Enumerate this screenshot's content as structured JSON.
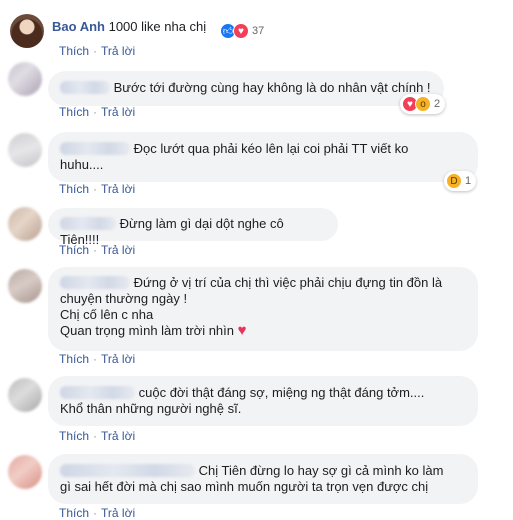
{
  "comments": [
    {
      "author": "Bao Anh",
      "lines": [
        "1000 like nha chị"
      ],
      "actions": {
        "like": "Thích",
        "reply": "Trả lời"
      },
      "reactions": {
        "count": "37",
        "icons": [
          "like-icon",
          "love-icon"
        ]
      }
    },
    {
      "author": "",
      "lines": [
        "Bước tới đường cùng hay không là do nhân vật chính !"
      ],
      "actions": {
        "like": "Thích",
        "reply": "Trả lời"
      },
      "reactions": {
        "count": "2",
        "icons": [
          "love-icon",
          "wow-icon"
        ]
      }
    },
    {
      "author": "",
      "lines": [
        "Đọc lướt qua phải kéo lên lại coi phải TT viết ko",
        "huhu...."
      ],
      "actions": {
        "like": "Thích",
        "reply": "Trả lời"
      },
      "reactions": {
        "count": "1",
        "icons": [
          "haha-icon"
        ]
      }
    },
    {
      "author": "",
      "lines": [
        "Đừng làm gì dại dột nghe cô Tiên!!!!"
      ],
      "actions": {
        "like": "Thích",
        "reply": "Trả lời"
      }
    },
    {
      "author": "",
      "lines": [
        "Đứng ở vị trí của chị thì việc phải chịu đựng tin đồn là",
        "chuyện thường ngày !",
        "Chị cố lên c nha",
        "Quan trọng mình làm trời nhìn"
      ],
      "actions": {
        "like": "Thích",
        "reply": "Trả lời"
      },
      "heart": "♥"
    },
    {
      "author": "",
      "lines": [
        "cuộc đời thật đáng sợ, miệng ng thật đáng tởm....",
        "Khổ thân những người nghệ sĩ."
      ],
      "actions": {
        "like": "Thích",
        "reply": "Trả lời"
      }
    },
    {
      "author": "",
      "lines": [
        "Chị Tiên đừng lo hay sợ gì cả mình ko làm",
        "gì sai hết đời mà chị sao mình muốn người ta trọn vẹn được chị"
      ],
      "actions": {
        "like": "Thích",
        "reply": "Trả lời"
      }
    }
  ],
  "colors": {
    "link": "#385898",
    "bubble": "#f2f3f5",
    "like": "#1877f2",
    "love": "#f33e58"
  }
}
